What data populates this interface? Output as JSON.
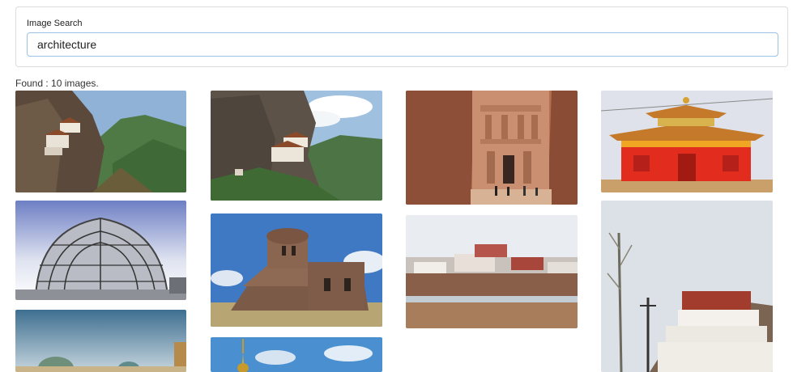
{
  "search": {
    "label": "Image Search",
    "value": "architecture"
  },
  "results": {
    "found_text": "Found : 10 images."
  },
  "images": [
    {
      "name": "cliff-monastery-image"
    },
    {
      "name": "glass-dome-image"
    },
    {
      "name": "mosque-domes-image"
    },
    {
      "name": "mountain-monastery-image"
    },
    {
      "name": "stone-church-image"
    },
    {
      "name": "golden-spire-image"
    },
    {
      "name": "rock-canyon-temple-image"
    },
    {
      "name": "hillside-monastery-town-image"
    },
    {
      "name": "red-temple-image"
    },
    {
      "name": "white-hill-monastery-image"
    }
  ]
}
